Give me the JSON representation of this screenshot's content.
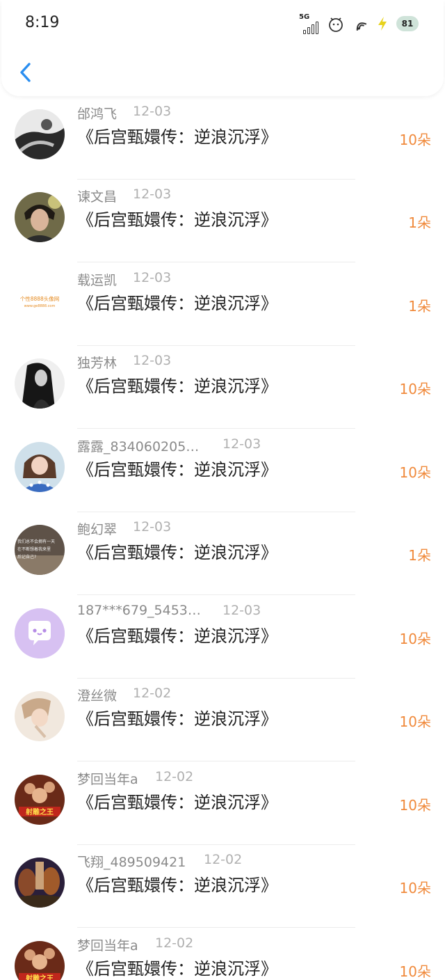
{
  "status_bar": {
    "time": "8:19",
    "network": "5G",
    "battery": "81",
    "icons": [
      "signal-5g-icon",
      "alarm-icon",
      "wifi-icon",
      "charging-bolt-icon",
      "battery-icon"
    ]
  },
  "nav": {
    "back_icon": "chevron-left-icon"
  },
  "items": [
    {
      "name": "邰鸿飞",
      "date": "12-03",
      "title": "《后宫甄嬛传：逆浪沉浮》",
      "amount": "10朵",
      "avatar": "photo"
    },
    {
      "name": "谏文昌",
      "date": "12-03",
      "title": "《后宫甄嬛传：逆浪沉浮》",
      "amount": "1朵",
      "avatar": "photo"
    },
    {
      "name": "载运凯",
      "date": "12-03",
      "title": "《后宫甄嬛传：逆浪沉浮》",
      "amount": "1朵",
      "avatar": "logo",
      "avatar_text": "个性8888头像网",
      "avatar_subtext": "www.ge8888.com"
    },
    {
      "name": "独芳林",
      "date": "12-03",
      "title": "《后宫甄嬛传：逆浪沉浮》",
      "amount": "10朵",
      "avatar": "photo"
    },
    {
      "name": "露露_834060205…",
      "date": "12-03",
      "title": "《后宫甄嬛传：逆浪沉浮》",
      "amount": "10朵",
      "avatar": "photo"
    },
    {
      "name": "鲍幻翠",
      "date": "12-03",
      "title": "《后宫甄嬛传：逆浪沉浮》",
      "amount": "1朵",
      "avatar": "text",
      "avatar_text": "我们总不会拥有一天 在不断想着我来里 后记自己?"
    },
    {
      "name": "187***679_5453…",
      "date": "12-03",
      "title": "《后宫甄嬛传：逆浪沉浮》",
      "amount": "10朵",
      "avatar": "default"
    },
    {
      "name": "澄丝微",
      "date": "12-02",
      "title": "《后宫甄嬛传：逆浪沉浮》",
      "amount": "10朵",
      "avatar": "photo"
    },
    {
      "name": "梦回当年a",
      "date": "12-02",
      "title": "《后宫甄嬛传：逆浪沉浮》",
      "amount": "10朵",
      "avatar": "poster",
      "avatar_text": "射雕之王"
    },
    {
      "name": "飞翔_489509421",
      "date": "12-02",
      "title": "《后宫甄嬛传：逆浪沉浮》",
      "amount": "10朵",
      "avatar": "poster"
    },
    {
      "name": "梦回当年a",
      "date": "12-02",
      "title": "《后宫甄嬛传：逆浪沉浮》",
      "amount": "10朵",
      "avatar": "poster",
      "avatar_text": "射雕之王"
    }
  ],
  "colors": {
    "accent": "#f08a3c",
    "back": "#2a8ef0",
    "name": "#8a8a8a",
    "title": "#222222"
  }
}
